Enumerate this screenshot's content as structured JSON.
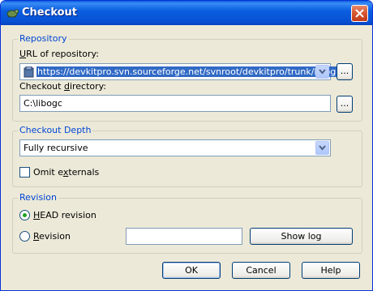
{
  "window": {
    "title": "Checkout"
  },
  "repository": {
    "group_label": "Repository",
    "url_label_pre": "",
    "url_label_u": "U",
    "url_label_post": "RL of repository:",
    "url_value": "https://devkitpro.svn.sourceforge.net/svnroot/devkitpro/trunk/libogc",
    "browse_label": "...",
    "dir_label_pre": "Checkout ",
    "dir_label_u": "d",
    "dir_label_post": "irectory:",
    "dir_value": "C:\\libogc",
    "dir_browse_label": "..."
  },
  "depth": {
    "group_label": "Checkout Depth",
    "selected": "Fully recursive",
    "omit_pre": "Omit e",
    "omit_u": "x",
    "omit_post": "ternals",
    "omit_checked": false
  },
  "revision": {
    "group_label": "Revision",
    "head_pre": "",
    "head_u": "H",
    "head_post": "EAD revision",
    "rev_pre": "",
    "rev_u": "R",
    "rev_post": "evision",
    "rev_value": "",
    "show_log_label": "Show log"
  },
  "buttons": {
    "ok": "OK",
    "cancel": "Cancel",
    "help": "Help"
  }
}
